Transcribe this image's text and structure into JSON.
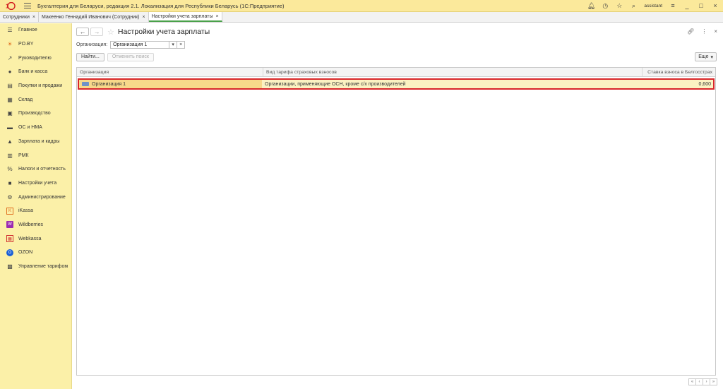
{
  "app": {
    "title": "Бухгалтерия для Беларуси, редакция 2.1. Локализация для Республики Беларусь  (1С:Предприятие)",
    "user": "assistant"
  },
  "tabs": [
    {
      "label": "Сотрудники",
      "closable": true,
      "active": false
    },
    {
      "label": "Макеенко Геннадий Иванович (Сотрудник)",
      "closable": true,
      "active": false
    },
    {
      "label": "Настройки учета зарплаты",
      "closable": true,
      "active": true
    }
  ],
  "sidebar": {
    "items": [
      {
        "label": "Главное",
        "icon": "menu-icon"
      },
      {
        "label": "PO.BY",
        "icon": "sun-icon"
      },
      {
        "label": "Руководителю",
        "icon": "chart-icon"
      },
      {
        "label": "Банк и касса",
        "icon": "coin-icon"
      },
      {
        "label": "Покупки и продажи",
        "icon": "cart-icon"
      },
      {
        "label": "Склад",
        "icon": "warehouse-icon"
      },
      {
        "label": "Производство",
        "icon": "factory-icon"
      },
      {
        "label": "ОС и НМА",
        "icon": "truck-icon"
      },
      {
        "label": "Зарплата и кадры",
        "icon": "person-icon"
      },
      {
        "label": "РМК",
        "icon": "cash-register-icon"
      },
      {
        "label": "Налоги и отчетность",
        "icon": "percent-icon"
      },
      {
        "label": "Настройки учета",
        "icon": "book-icon"
      },
      {
        "label": "Администрирование",
        "icon": "gear-icon"
      },
      {
        "label": "iKassa",
        "icon": "ikassa-icon"
      },
      {
        "label": "Wildberries",
        "icon": "wildberries-icon"
      },
      {
        "label": "Webkassa",
        "icon": "webkassa-icon"
      },
      {
        "label": "OZON",
        "icon": "ozon-icon"
      },
      {
        "label": "Управление тарифом",
        "icon": "tariff-icon"
      }
    ]
  },
  "main": {
    "title": "Настройки учета зарплаты",
    "filter": {
      "label": "Организация:",
      "value": "Организация 1"
    },
    "buttons": {
      "find": "Найти...",
      "cancel_search": "Отменить поиск",
      "more": "Еще"
    },
    "table": {
      "columns": [
        "Организация",
        "Вид тарифа страховых взносов",
        "Ставка взноса в Белгосстрах"
      ],
      "rows": [
        {
          "organization": "Организация 1",
          "tariff": "Организации, применяющие ОСН, кроме с/х производителей",
          "rate": "0,600"
        }
      ]
    }
  }
}
